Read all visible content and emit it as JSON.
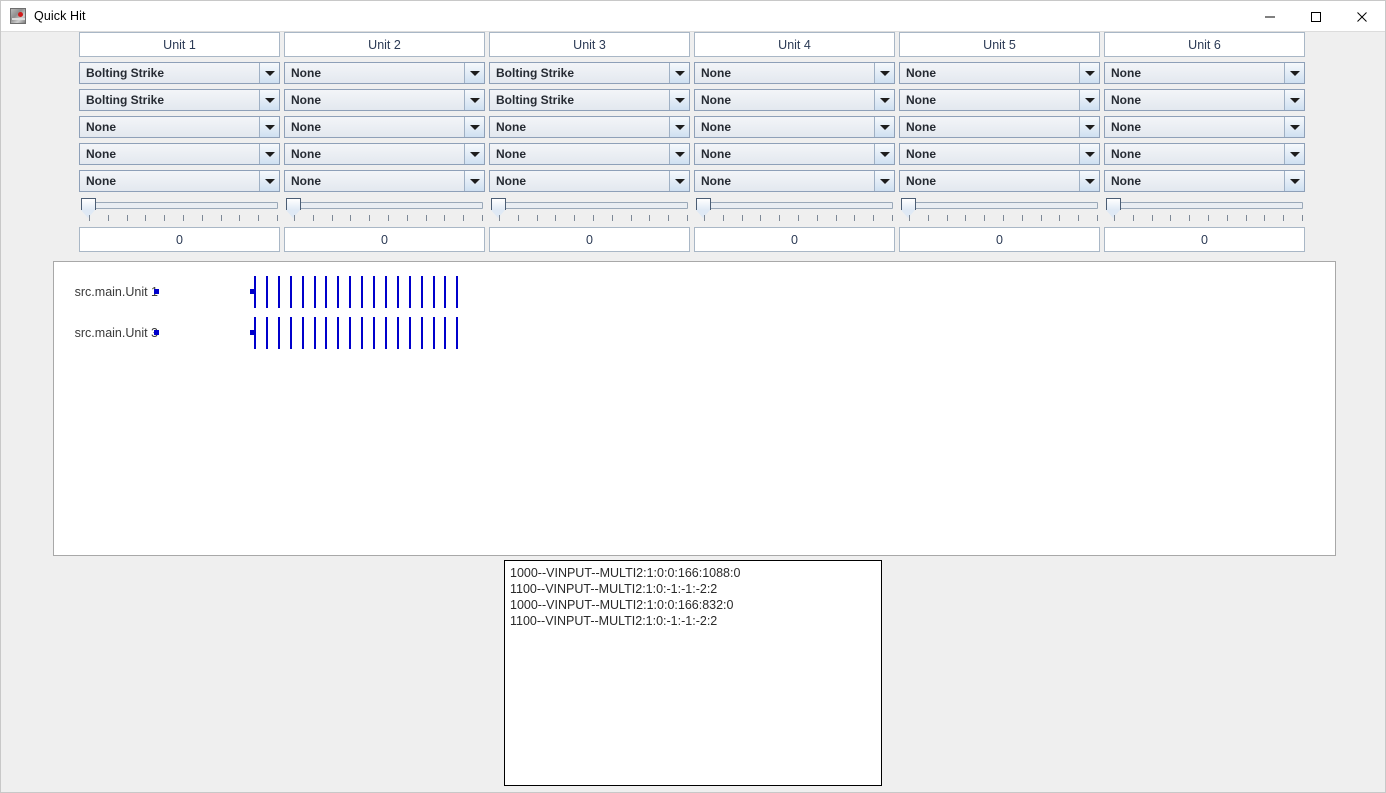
{
  "window": {
    "title": "Quick Hit",
    "icon": "matlab-app-icon",
    "controls": {
      "minimize": "minimize-icon",
      "maximize": "maximize-icon",
      "close": "close-icon"
    }
  },
  "units": [
    {
      "header": "Unit 1",
      "selects": [
        "Bolting Strike",
        "Bolting Strike",
        "None",
        "None",
        "None"
      ],
      "slider_value": 0,
      "value_text": "0"
    },
    {
      "header": "Unit 2",
      "selects": [
        "None",
        "None",
        "None",
        "None",
        "None"
      ],
      "slider_value": 0,
      "value_text": "0"
    },
    {
      "header": "Unit 3",
      "selects": [
        "Bolting Strike",
        "Bolting Strike",
        "None",
        "None",
        "None"
      ],
      "slider_value": 0,
      "value_text": "0"
    },
    {
      "header": "Unit 4",
      "selects": [
        "None",
        "None",
        "None",
        "None",
        "None"
      ],
      "slider_value": 0,
      "value_text": "0"
    },
    {
      "header": "Unit 5",
      "selects": [
        "None",
        "None",
        "None",
        "None",
        "None"
      ],
      "slider_value": 0,
      "value_text": "0"
    },
    {
      "header": "Unit 6",
      "selects": [
        "None",
        "None",
        "None",
        "None",
        "None"
      ],
      "slider_value": 0,
      "value_text": "0"
    }
  ],
  "dropdown_options": [
    "None",
    "Bolting Strike"
  ],
  "chart": {
    "series": [
      {
        "label": "src.main.Unit 1",
        "marker_color": "#0000cc",
        "pulse_count": 18
      },
      {
        "label": "src.main.Unit 3",
        "marker_color": "#0000cc",
        "pulse_count": 18
      }
    ]
  },
  "log": {
    "lines": [
      "1000--VINPUT--MULTI2:1:0:0:166:1088:0",
      "1100--VINPUT--MULTI2:1:0:-1:-1:-2:2",
      "1000--VINPUT--MULTI2:1:0:0:166:832:0",
      "1100--VINPUT--MULTI2:1:0:-1:-1:-2:2"
    ]
  },
  "colors": {
    "accent": "#0000cc",
    "panel_bg": "#efefef",
    "field_bg": "#ffffff",
    "combo_border": "#8ea0b8",
    "header_text": "#2b3a55"
  }
}
